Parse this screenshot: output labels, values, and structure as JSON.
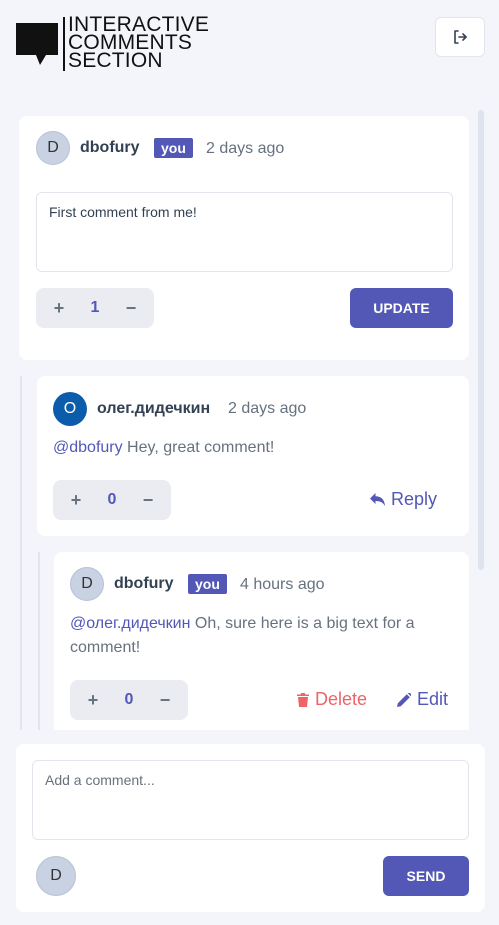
{
  "header": {
    "logo_lines": [
      "INTERACTIVE",
      "COMMENTS",
      "SECTION"
    ],
    "logo_icon": "speech-bubble-icon",
    "logout_icon": "logout-icon"
  },
  "comments": [
    {
      "initial": "D",
      "username": "dbofury",
      "you_badge": "you",
      "time": "2 days ago",
      "editing_text": "First comment from me!",
      "score": "1",
      "update_label": "UPDATE"
    },
    {
      "initial": "О",
      "username": "олег.дидечкин",
      "time": "2 days ago",
      "mention": "@dbofury",
      "text": " Hey, great comment!",
      "score": "0",
      "reply_label": "Reply"
    },
    {
      "initial": "D",
      "username": "dbofury",
      "you_badge": "you",
      "time": "4 hours ago",
      "mention": "@олег.дидечкин",
      "text": " Oh, sure here is a big text for a comment!",
      "score": "0",
      "delete_label": "Delete",
      "edit_label": "Edit"
    }
  ],
  "vote": {
    "plus": "+",
    "minus": "−"
  },
  "composer": {
    "placeholder": "Add a comment...",
    "initial": "D",
    "send_label": "SEND"
  },
  "colors": {
    "accent": "#5357b6",
    "danger": "#ed6368",
    "background": "#f4f5fa"
  }
}
